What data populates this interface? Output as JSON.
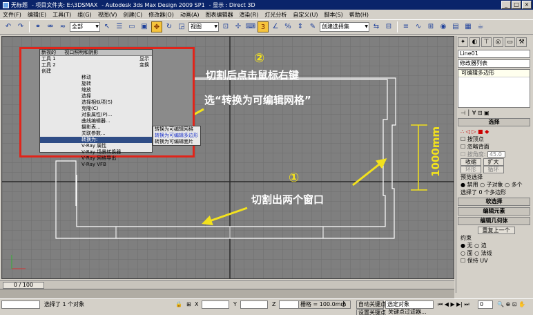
{
  "titlebar": {
    "segments": [
      "无标题",
      "- 项目文件夹: E:\\3DSMAX",
      "- Autodesk 3ds Max Design 2009 SP1",
      "- 显示 : Direct 3D"
    ]
  },
  "menu": [
    "文件(F)",
    "编辑(E)",
    "工具(T)",
    "组(G)",
    "视图(V)",
    "创建(C)",
    "修改器(O)",
    "动画(A)",
    "图表编辑器",
    "渲染(R)",
    "灯光分析",
    "自定义(U)",
    "脚本(S)",
    "帮助(H)"
  ],
  "toolbar": {
    "selection_filter": "全部",
    "ref_coord": "视图",
    "named_selection": "创建选择集"
  },
  "context_menu": {
    "header_left": "新视的",
    "header_right": "视口照明和阴影",
    "tools": [
      "工具 1",
      "工具 2"
    ],
    "sections": [
      "显示",
      "变换"
    ],
    "items": [
      "创建",
      "移动",
      "旋转",
      "缩放",
      "选择",
      "选择相似项(S)",
      "克隆(C)",
      "对象属性(P)...",
      "曲线编辑器...",
      "摄影表...",
      "关联参数...",
      "转换为:",
      "V-Ray 属性",
      "V-Ray 场景转换器",
      "V-Ray 网格导出",
      "V-Ray VFB",
      "V-Ray 场景导出器"
    ],
    "submenu": [
      "转换为可编辑网格",
      "转换为可编辑多边形",
      "转换为可编辑面片"
    ]
  },
  "annotations": {
    "num2": "②",
    "num1": "①",
    "text_top1": "切割后点击鼠标右键",
    "text_top2": "选“转换为可编辑网格”",
    "text_bottom": "切割出两个窗口",
    "dimension": "1000mm"
  },
  "panel": {
    "object_name": "Line01",
    "modifier_list": "修改器列表",
    "stack_item": "可编辑多边形",
    "rollout_select": "选择",
    "by_vertex": "按顶点",
    "ignore_backface": "忽略背面",
    "by_angle": "按角度:",
    "angle_value": "45.0",
    "shrink": "收缩",
    "grow": "扩大",
    "ring": "环形",
    "loop": "循环",
    "preview_select": "预览选择",
    "disable": "禁用",
    "sub_object": "子对象",
    "multi": "多个",
    "selected_count": "选择了 0 个多边形",
    "rollout_soft": "软选择",
    "rollout_edit_elements": "编辑元素",
    "rollout_edit_geometry": "编辑几何体",
    "repeat_last": "重复上一个",
    "constraints": "约束",
    "c_none": "无",
    "c_edge": "边",
    "c_face": "面",
    "c_normal": "法线",
    "preserve_uv": "保持 UV"
  },
  "timeline": {
    "slider": "0 / 100"
  },
  "status": {
    "selected": "选择了 1 个对象",
    "x_label": "X",
    "y_label": "Y",
    "z_label": "Z",
    "grid": "栅格 = 100.0mm",
    "auto_key": "自动关键点",
    "set_key": "设置关键点",
    "selected_object": "选定对象",
    "key_filter": "关键点过滤器...",
    "frame": "0"
  }
}
